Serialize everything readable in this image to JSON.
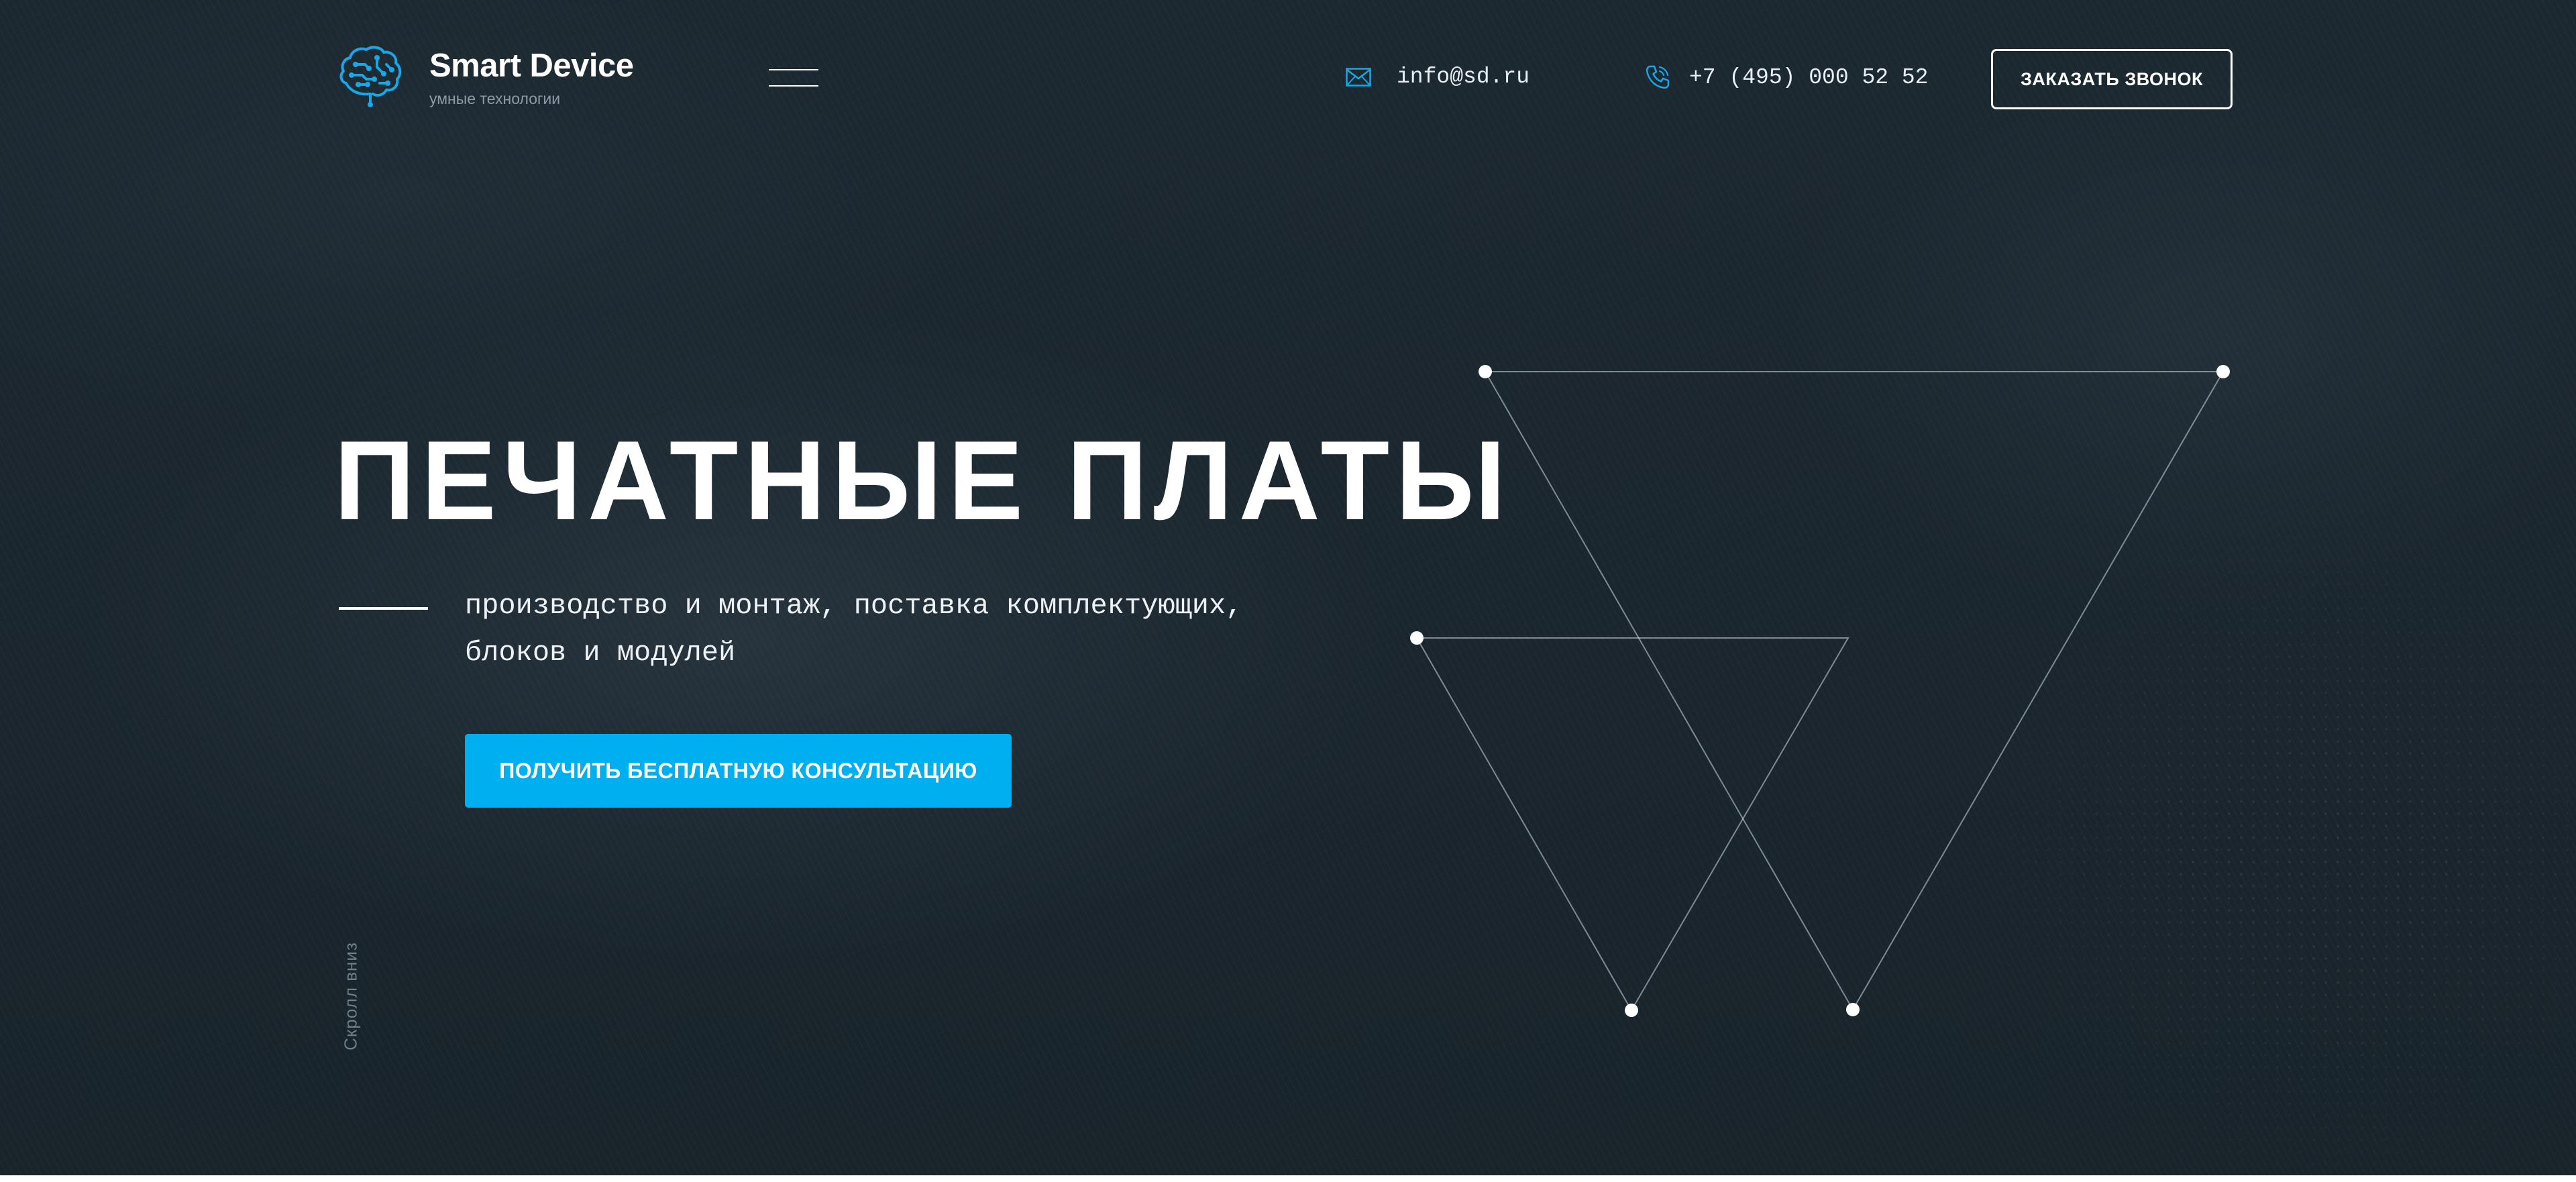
{
  "header": {
    "logo": {
      "title": "Smart Device",
      "subtitle": "умные технологии"
    },
    "menu_icon": "burger-icon",
    "email": "info@sd.ru",
    "email_icon": "envelope-icon",
    "phone": "+7 (495) 000 52 52",
    "phone_icon": "phone-icon",
    "callback_label": "ЗАКАЗАТЬ ЗВОНОК"
  },
  "hero": {
    "title": "ПЕЧАТНЫЕ ПЛАТЫ",
    "subtitle": "производство и монтаж, поставка комплектующих, блоков и модулей",
    "cta_label": "ПОЛУЧИТЬ БЕСПЛАТНУЮ КОНСУЛЬТАЦИЮ",
    "scroll_label": "Скролл вниз"
  },
  "colors": {
    "background": "#1b262e",
    "accent": "#00aff0",
    "text": "#ffffff",
    "muted": "#8a9aa6"
  }
}
